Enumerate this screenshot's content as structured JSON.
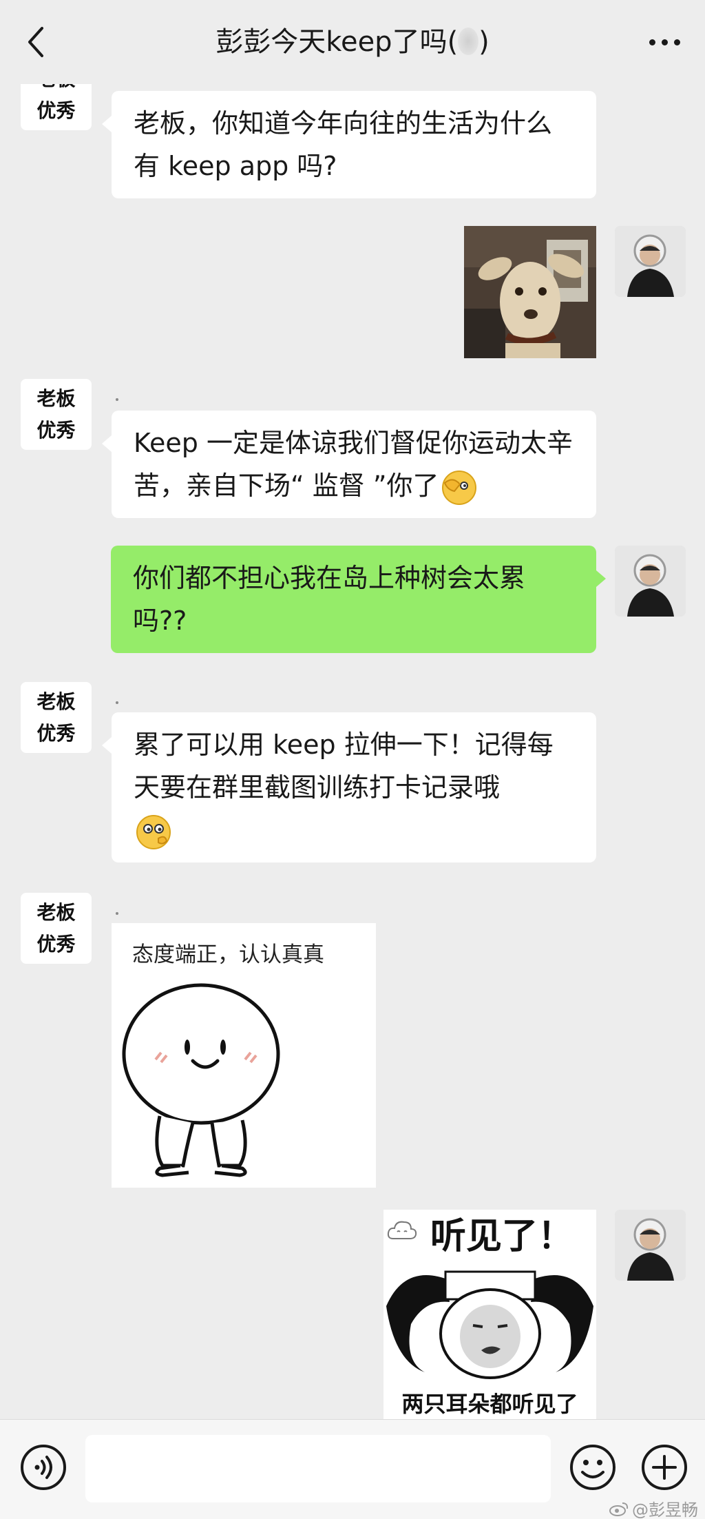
{
  "header": {
    "title": "彭彭今天keep了吗(",
    "title_suffix": ")"
  },
  "contact": {
    "avatar_line1": "老板",
    "avatar_line2": "优秀"
  },
  "messages": [
    {
      "text": "老板，你知道今年向往的生活为什么有 keep app 吗?"
    },
    {
      "image": "dog-photo"
    },
    {
      "text": "Keep 一定是体谅我们督促你运动太辛苦，亲自下场“ 监督 ”你了"
    },
    {
      "text": "你们都不担心我在岛上种树会太累吗??"
    },
    {
      "text": "累了可以用 keep 拉伸一下！记得每天要在群里截图训练打卡记录哦"
    },
    {
      "sticker_caption": "态度端正，认认真真"
    },
    {
      "sticker_top": "听见了！",
      "sticker_bottom": "两只耳朵都听见了"
    }
  ],
  "input_bar": {
    "placeholder": ""
  },
  "watermark": "@彭昱畅",
  "colors": {
    "background": "#ededed",
    "bubble_self": "#95ec69",
    "bubble_other": "#ffffff"
  }
}
